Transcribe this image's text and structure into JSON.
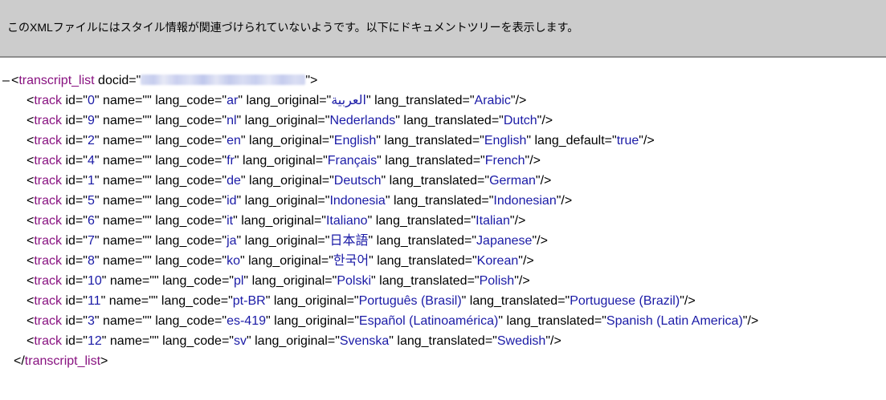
{
  "header": {
    "message": "このXMLファイルにはスタイル情報が関連づけられていないようです。以下にドキュメントツリーを表示します。"
  },
  "xml": {
    "collapse_glyph": "–",
    "root_tag": "transcript_list",
    "root_attr": "docid",
    "child_tag": "track",
    "tracks": [
      {
        "id": "0",
        "name": "",
        "lang_code": "ar",
        "lang_original": "العربية",
        "lang_translated": "Arabic"
      },
      {
        "id": "9",
        "name": "",
        "lang_code": "nl",
        "lang_original": "Nederlands",
        "lang_translated": "Dutch"
      },
      {
        "id": "2",
        "name": "",
        "lang_code": "en",
        "lang_original": "English",
        "lang_translated": "English",
        "lang_default": "true"
      },
      {
        "id": "4",
        "name": "",
        "lang_code": "fr",
        "lang_original": "Français",
        "lang_translated": "French"
      },
      {
        "id": "1",
        "name": "",
        "lang_code": "de",
        "lang_original": "Deutsch",
        "lang_translated": "German"
      },
      {
        "id": "5",
        "name": "",
        "lang_code": "id",
        "lang_original": "Indonesia",
        "lang_translated": "Indonesian"
      },
      {
        "id": "6",
        "name": "",
        "lang_code": "it",
        "lang_original": "Italiano",
        "lang_translated": "Italian"
      },
      {
        "id": "7",
        "name": "",
        "lang_code": "ja",
        "lang_original": "日本語",
        "lang_translated": "Japanese"
      },
      {
        "id": "8",
        "name": "",
        "lang_code": "ko",
        "lang_original": "한국어",
        "lang_translated": "Korean"
      },
      {
        "id": "10",
        "name": "",
        "lang_code": "pl",
        "lang_original": "Polski",
        "lang_translated": "Polish"
      },
      {
        "id": "11",
        "name": "",
        "lang_code": "pt-BR",
        "lang_original": "Português (Brasil)",
        "lang_translated": "Portuguese (Brazil)"
      },
      {
        "id": "3",
        "name": "",
        "lang_code": "es-419",
        "lang_original": "Español (Latinoamérica)",
        "lang_translated": "Spanish (Latin America)"
      },
      {
        "id": "12",
        "name": "",
        "lang_code": "sv",
        "lang_original": "Svenska",
        "lang_translated": "Swedish"
      }
    ]
  },
  "colors": {
    "header_bg": "#cccccc",
    "tag": "#881280",
    "attr_value": "#1a1aa6",
    "attr_name": "#000000"
  }
}
